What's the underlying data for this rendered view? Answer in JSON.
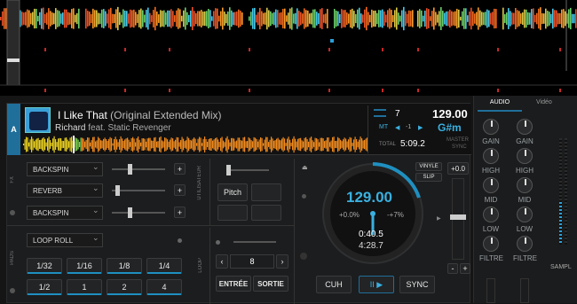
{
  "deck": {
    "letter": "A",
    "title": "I Like That",
    "mix": " (Original Extended Mix)",
    "artist": "Richard",
    "feat": " feat. Static Revenger",
    "remain": "5:09.2",
    "total_label": "TOTAL",
    "track_no": "7",
    "bpm": "129.00",
    "key": "G#m",
    "mt": "MT",
    "pitch_dn": "-1",
    "pitch_up": "+1",
    "master": "MASTER",
    "sync_lbl": "SYNC"
  },
  "fx": {
    "tab": "FX",
    "tab2": "UTILISATEUR",
    "items": [
      "BACKSPIN",
      "REVERB",
      "BACKSPIN"
    ],
    "pitch_btn": "Pitch"
  },
  "loop": {
    "tab": "PADS",
    "tab2": "LOOP",
    "mode": "LOOP ROLL",
    "pads_top": [
      "1/32",
      "1/16",
      "1/8",
      "1/4"
    ],
    "pads_bot": [
      "1/2",
      "1",
      "2",
      "4"
    ],
    "loop_len": "8",
    "in": "ENTRÉE",
    "out": "SORTIE"
  },
  "jog": {
    "bpm": "129.00",
    "pct": "+0.0%",
    "range": "-+7%",
    "time1": "0:40.5",
    "time2": "4:28.7",
    "vinyl": "VINYLE",
    "slip": "SLIP",
    "pitch": "+0.0",
    "cue": "CUH",
    "play": "II ▶",
    "sync": "SYNC",
    "minus": "-",
    "plus": "+"
  },
  "mixer": {
    "tab_audio": "AUDIO",
    "tab_video": "Vidéo",
    "gain": "GAIN",
    "high": "HIGH",
    "mid": "MID",
    "low": "LOW",
    "filter": "FILTRE",
    "sampler": "SAMPL"
  }
}
